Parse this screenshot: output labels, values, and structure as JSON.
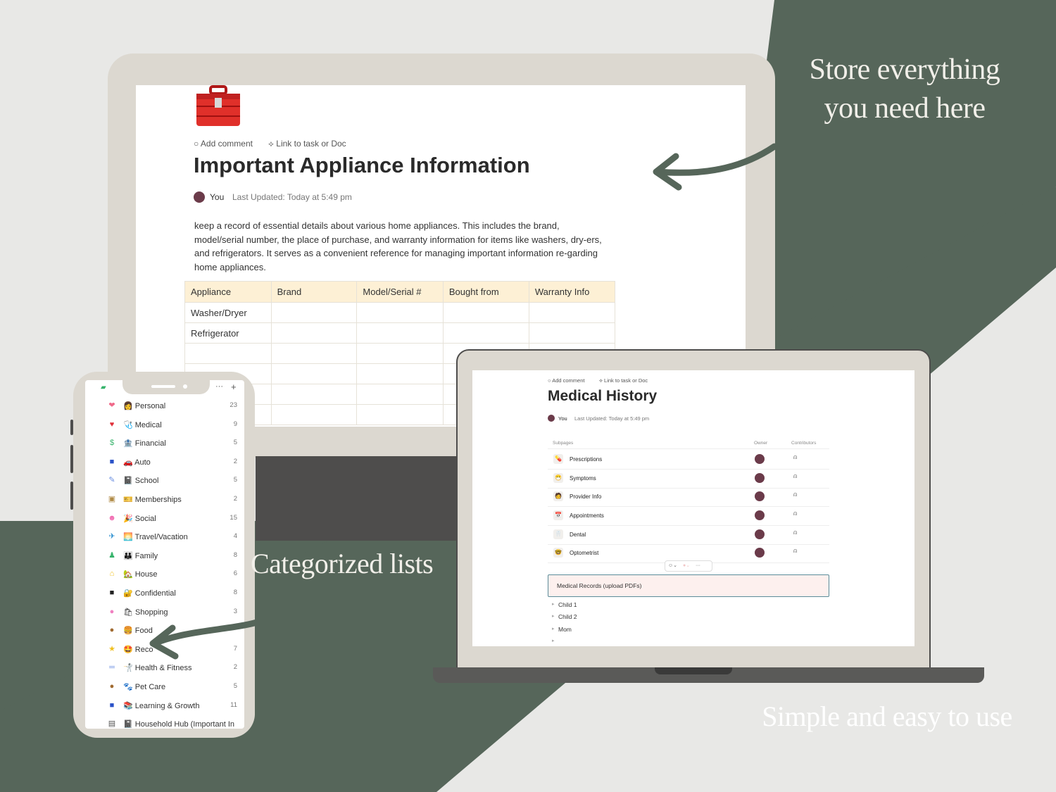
{
  "headlines": {
    "store": "Store everything you need here",
    "categorized": "Categorized lists",
    "simple": "Simple and easy to use"
  },
  "colors": {
    "brand_green": "#56665a",
    "frame_beige": "#dcd8d0",
    "table_header": "#fdf0d5",
    "background": "#e8e8e6"
  },
  "appliance_doc": {
    "icon": "toolbox-icon",
    "add_comment": "Add comment",
    "link_task": "Link to task or Doc",
    "title": "Important Appliance Information",
    "author": "You",
    "last_updated": "Last Updated: Today at 5:49 pm",
    "description": "keep a record of essential details about various home appliances. This includes the brand, model/serial number, the place of purchase, and warranty information for items like washers, dry-ers, and refrigerators. It serves as a convenient reference for managing important information re-garding home appliances.",
    "table": {
      "headers": [
        "Appliance",
        "Brand",
        "Model/Serial #",
        "Bought from",
        "Warranty Info"
      ],
      "rows": [
        [
          "Washer/Dryer",
          "",
          "",
          "",
          ""
        ],
        [
          "Refrigerator",
          "",
          "",
          "",
          ""
        ],
        [
          "",
          "",
          "",
          "",
          ""
        ],
        [
          "",
          "",
          "",
          "",
          ""
        ],
        [
          "",
          "",
          "",
          "",
          ""
        ],
        [
          "",
          "",
          "",
          "",
          ""
        ]
      ]
    }
  },
  "phone": {
    "toolbar_more": "···",
    "toolbar_add": "+",
    "categories": [
      {
        "icon": "heart-icon",
        "label": "👩 Personal",
        "count": "23",
        "color": "#f06a8a",
        "glyph": "❤"
      },
      {
        "icon": "heartbeat-icon",
        "label": "🩺 Medical",
        "count": "9",
        "color": "#e0303a",
        "glyph": "♥"
      },
      {
        "icon": "money-icon",
        "label": "🏦 Financial",
        "count": "5",
        "color": "#36b36b",
        "glyph": "$"
      },
      {
        "icon": "car-icon",
        "label": "🚗 Auto",
        "count": "2",
        "color": "#2a52c8",
        "glyph": "■"
      },
      {
        "icon": "pencil-icon",
        "label": "📓 School",
        "count": "5",
        "color": "#6a8ee0",
        "glyph": "✎"
      },
      {
        "icon": "id-card-icon",
        "label": "🎫 Memberships",
        "count": "2",
        "color": "#b08a46",
        "glyph": "▣"
      },
      {
        "icon": "smile-icon",
        "label": "🎉 Social",
        "count": "15",
        "color": "#f06ab0",
        "glyph": "☻"
      },
      {
        "icon": "plane-icon",
        "label": "🌅 Travel/Vacation",
        "count": "4",
        "color": "#2a8ed0",
        "glyph": "✈"
      },
      {
        "icon": "people-icon",
        "label": "👪 Family",
        "count": "8",
        "color": "#36b36b",
        "glyph": "♟"
      },
      {
        "icon": "home-icon",
        "label": "🏡 House",
        "count": "6",
        "color": "#f0c020",
        "glyph": "⌂"
      },
      {
        "icon": "lock-icon",
        "label": "🔐 Confidential",
        "count": "8",
        "color": "#222222",
        "glyph": "■"
      },
      {
        "icon": "bag-icon",
        "label": "🛍 Shopping",
        "count": "3",
        "color": "#f080c0",
        "glyph": "●"
      },
      {
        "icon": "drumstick-icon",
        "label": "🍔 Food",
        "count": "",
        "color": "#a06a30",
        "glyph": "●"
      },
      {
        "icon": "star-icon",
        "label": "🤩 Reco",
        "count": "7",
        "color": "#f0c020",
        "glyph": "★"
      },
      {
        "icon": "dumbbell-icon",
        "label": "🤺 Health & Fitness",
        "count": "2",
        "color": "#6a8ee0",
        "glyph": "═"
      },
      {
        "icon": "bone-icon",
        "label": "🐾 Pet Care",
        "count": "5",
        "color": "#a06a30",
        "glyph": "●"
      },
      {
        "icon": "book-icon",
        "label": "📚 Learning & Growth",
        "count": "11",
        "color": "#2a52c8",
        "glyph": "■"
      },
      {
        "icon": "document-icon",
        "label": "📓 Household Hub (Important In",
        "count": "",
        "color": "#555555",
        "glyph": "▤"
      }
    ]
  },
  "medical_doc": {
    "add_comment": "Add comment",
    "link_task": "Link to task or Doc",
    "title": "Medical History",
    "author": "You",
    "last_updated": "Last Updated: Today at 5:49 pm",
    "columns": {
      "subpages": "Subpages",
      "owner": "Owner",
      "contributors": "Contributors"
    },
    "subpages": [
      {
        "icon": "pill-icon",
        "label": "Prescriptions"
      },
      {
        "icon": "sick-face-icon",
        "label": "Symptoms"
      },
      {
        "icon": "doctor-icon",
        "label": "Provider Info"
      },
      {
        "icon": "calendar-icon",
        "label": "Appointments"
      },
      {
        "icon": "tooth-icon",
        "label": "Dental"
      },
      {
        "icon": "glasses-icon",
        "label": "Optometrist"
      }
    ],
    "toolbar": {
      "emoji": "☺⌄",
      "color": "●⌄",
      "more": "···"
    },
    "records_box": "Medical Records (upload PDFs)",
    "children": [
      "Child 1",
      "Child 2",
      "Mom"
    ]
  }
}
